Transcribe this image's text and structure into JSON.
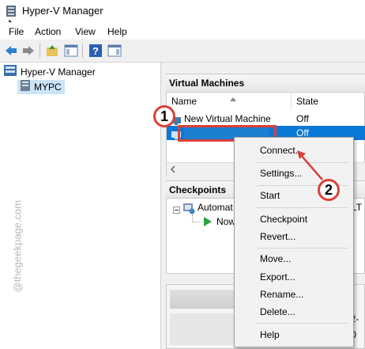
{
  "window": {
    "title": "Hyper-V Manager"
  },
  "menu": {
    "items": [
      "File",
      "Action",
      "View",
      "Help"
    ]
  },
  "tree": {
    "root": "Hyper-V Manager",
    "host": "MYPC"
  },
  "vm_section": {
    "header": "Virtual Machines",
    "columns": {
      "name": "Name",
      "state": "State"
    },
    "rows": [
      {
        "name": "New Virtual Machine",
        "state": "Off"
      },
      {
        "name": "",
        "state": "Off"
      }
    ]
  },
  "checkpoints_section": {
    "header": "Checkpoints",
    "items": [
      {
        "label": "Automat",
        "suffix": "LT"
      },
      {
        "label": "Now"
      }
    ]
  },
  "context_menu": {
    "items": [
      "Connect...",
      "Settings...",
      "Start",
      "Checkpoint",
      "Revert...",
      "Move...",
      "Export...",
      "Rename...",
      "Delete...",
      "Help"
    ]
  },
  "annotations": {
    "step1": "1",
    "step2": "2",
    "accent": "#d9413a"
  },
  "watermark": "@thegeekpage.com",
  "bottom_right_text": {
    "line1": "22-",
    "line2": ".0"
  }
}
